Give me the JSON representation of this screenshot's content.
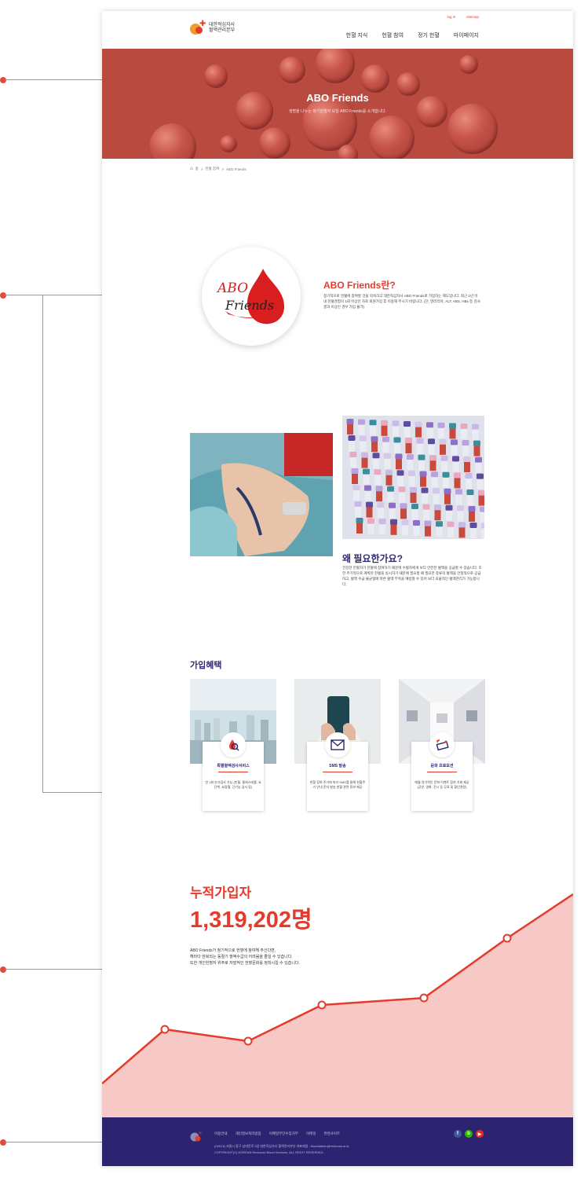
{
  "header": {
    "logo_line1": "대한적십자사",
    "logo_line2": "혈액관리본부",
    "util": [
      "log in",
      "sitemap"
    ],
    "nav": [
      "헌혈 지식",
      "헌혈 참여",
      "정기 헌혈",
      "마이페이지"
    ]
  },
  "hero": {
    "title": "ABO Friends",
    "subtitle": "생명을 나누는 정기헌혈자 모임 ABO Friends를 소개합니다."
  },
  "breadcrumb": [
    "홈",
    "헌혈 참여",
    "ABO Friends"
  ],
  "about": {
    "logo_text_1": "ABO",
    "logo_text_2": "Friends",
    "title": "ABO Friends란?",
    "desc": "정기적으로 헌혈에 참여할 것을 약속하고 대한적십자사 ABO Friends로 가입하는 제도입니다. 최근 1년 이내 헌혈경험이 1회 이상인 자로 회원가입 후 이용해 주시기 바랍니다. (단, 말라리아, ALT, ABS, HBs 등 검사결과 이상인 경우 가입 불가)"
  },
  "why": {
    "title": "왜 필요한가요?",
    "desc": "건강한 헌혈자가 헌혈에 참여하기 때문에 수혈자에게 보다 안전한 혈액을 공급할 수 있습니다. 또한 주기적으로 계획된 헌혈을 실시하기 때문에 필요할 때 필요한 종류의 혈액을 안정적으로 공급하고, 혈액 수급 불균형에 따른 혈액 부족을 예방할 수 있어 보다 효율적인 혈액관리가 가능합니다."
  },
  "benefits": {
    "title": "가입혜택",
    "cards": [
      {
        "icon": "blood-drop-search-icon",
        "name": "특별혈액검사서비스",
        "desc": "연 1회 추가검사 가능 (빈혈, 콜레스테롤, 요단백, 요잠혈, 간기능 검사 등)"
      },
      {
        "icon": "envelope-icon",
        "name": "SMS 발송",
        "desc": "헌혈 참여 주기에 따라 SMS를 통해 헌혈주기 안내 문자 발송 헌혈 관련 정보 제공"
      },
      {
        "icon": "ticket-icon",
        "name": "문화 프로모션",
        "desc": "매월 정기적인 문화 이벤트 참여 기회 제공 (공연, 영화, 전시 등 무료 및 할인관람)"
      }
    ]
  },
  "members": {
    "label": "누적가입자",
    "count": "1,319,202명",
    "desc": [
      "ABO Friends가 정기적으로 헌혈에 참여해 주신다면,",
      "해마다 반복되는 동절기 혈액수급의 어려움을 줄일 수 있습니다.",
      "또한 개인헌혈자 위주로 자발적인 헌혈문화를 정착시킬 수 있습니다."
    ]
  },
  "footer": {
    "links": [
      "이용안내",
      "개인정보처리방침",
      "이메일무단수집거부",
      "이메일",
      "관련사이트"
    ],
    "address": "(04513) 서울시 중구 남대문로 5길 대한적십자사 혈액관리본부 대표메일 : bloodadmin@redcross.or.kr",
    "copyright": "COPYRIGHT(C) KOREAN Redcross Blood Services. ALL RIGHT RESERVED.",
    "sns": [
      "f",
      "b",
      "▶"
    ]
  },
  "colors": {
    "accent": "#e53b2d",
    "navy": "#2c2470",
    "hero": "#b84a3f",
    "graph_fill": "#f7c9c6"
  }
}
